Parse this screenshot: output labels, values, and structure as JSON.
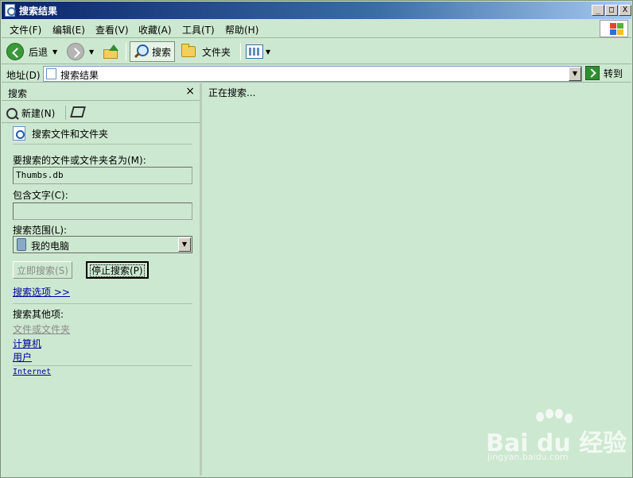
{
  "window": {
    "title": "搜索结果",
    "controls": {
      "minimize": "_",
      "maximize": "□",
      "close": "X"
    }
  },
  "menu": [
    {
      "label": "文件(F)"
    },
    {
      "label": "编辑(E)"
    },
    {
      "label": "查看(V)"
    },
    {
      "label": "收藏(A)"
    },
    {
      "label": "工具(T)"
    },
    {
      "label": "帮助(H)"
    }
  ],
  "toolbar": {
    "back_label": "后退",
    "search_label": "搜索",
    "folders_label": "文件夹",
    "icons": [
      "back-arrow-icon",
      "forward-arrow-icon",
      "up-folder-icon",
      "search-icon",
      "folder-icon",
      "views-icon"
    ]
  },
  "address": {
    "label": "地址(D)",
    "value": "搜索结果",
    "go_label": "转到"
  },
  "search_pane": {
    "title": "搜索",
    "close": "×",
    "new_label": "新建(N)",
    "section_title": "搜索文件和文件夹",
    "name_label": "要搜索的文件或文件夹名为(M):",
    "name_value": "Thumbs.db",
    "text_label": "包含文字(C):",
    "text_value": "",
    "scope_label": "搜索范围(L):",
    "scope_value": "我的电脑",
    "search_now_label": "立即搜索(S)",
    "stop_label": "停止搜索(P)",
    "options_link": "搜索选项 >>",
    "other_label": "搜索其他项:",
    "other_links": [
      "文件或文件夹",
      "计算机",
      "用户"
    ],
    "internet_link": " Internet"
  },
  "results": {
    "status": "正在搜索..."
  },
  "watermark": {
    "brand": "Bai  du 经验",
    "url": "jingyan.baidu.com"
  },
  "colors": {
    "pane_background": "#cde8d0",
    "link": "#00009c",
    "titlebar": "#0a246a"
  }
}
